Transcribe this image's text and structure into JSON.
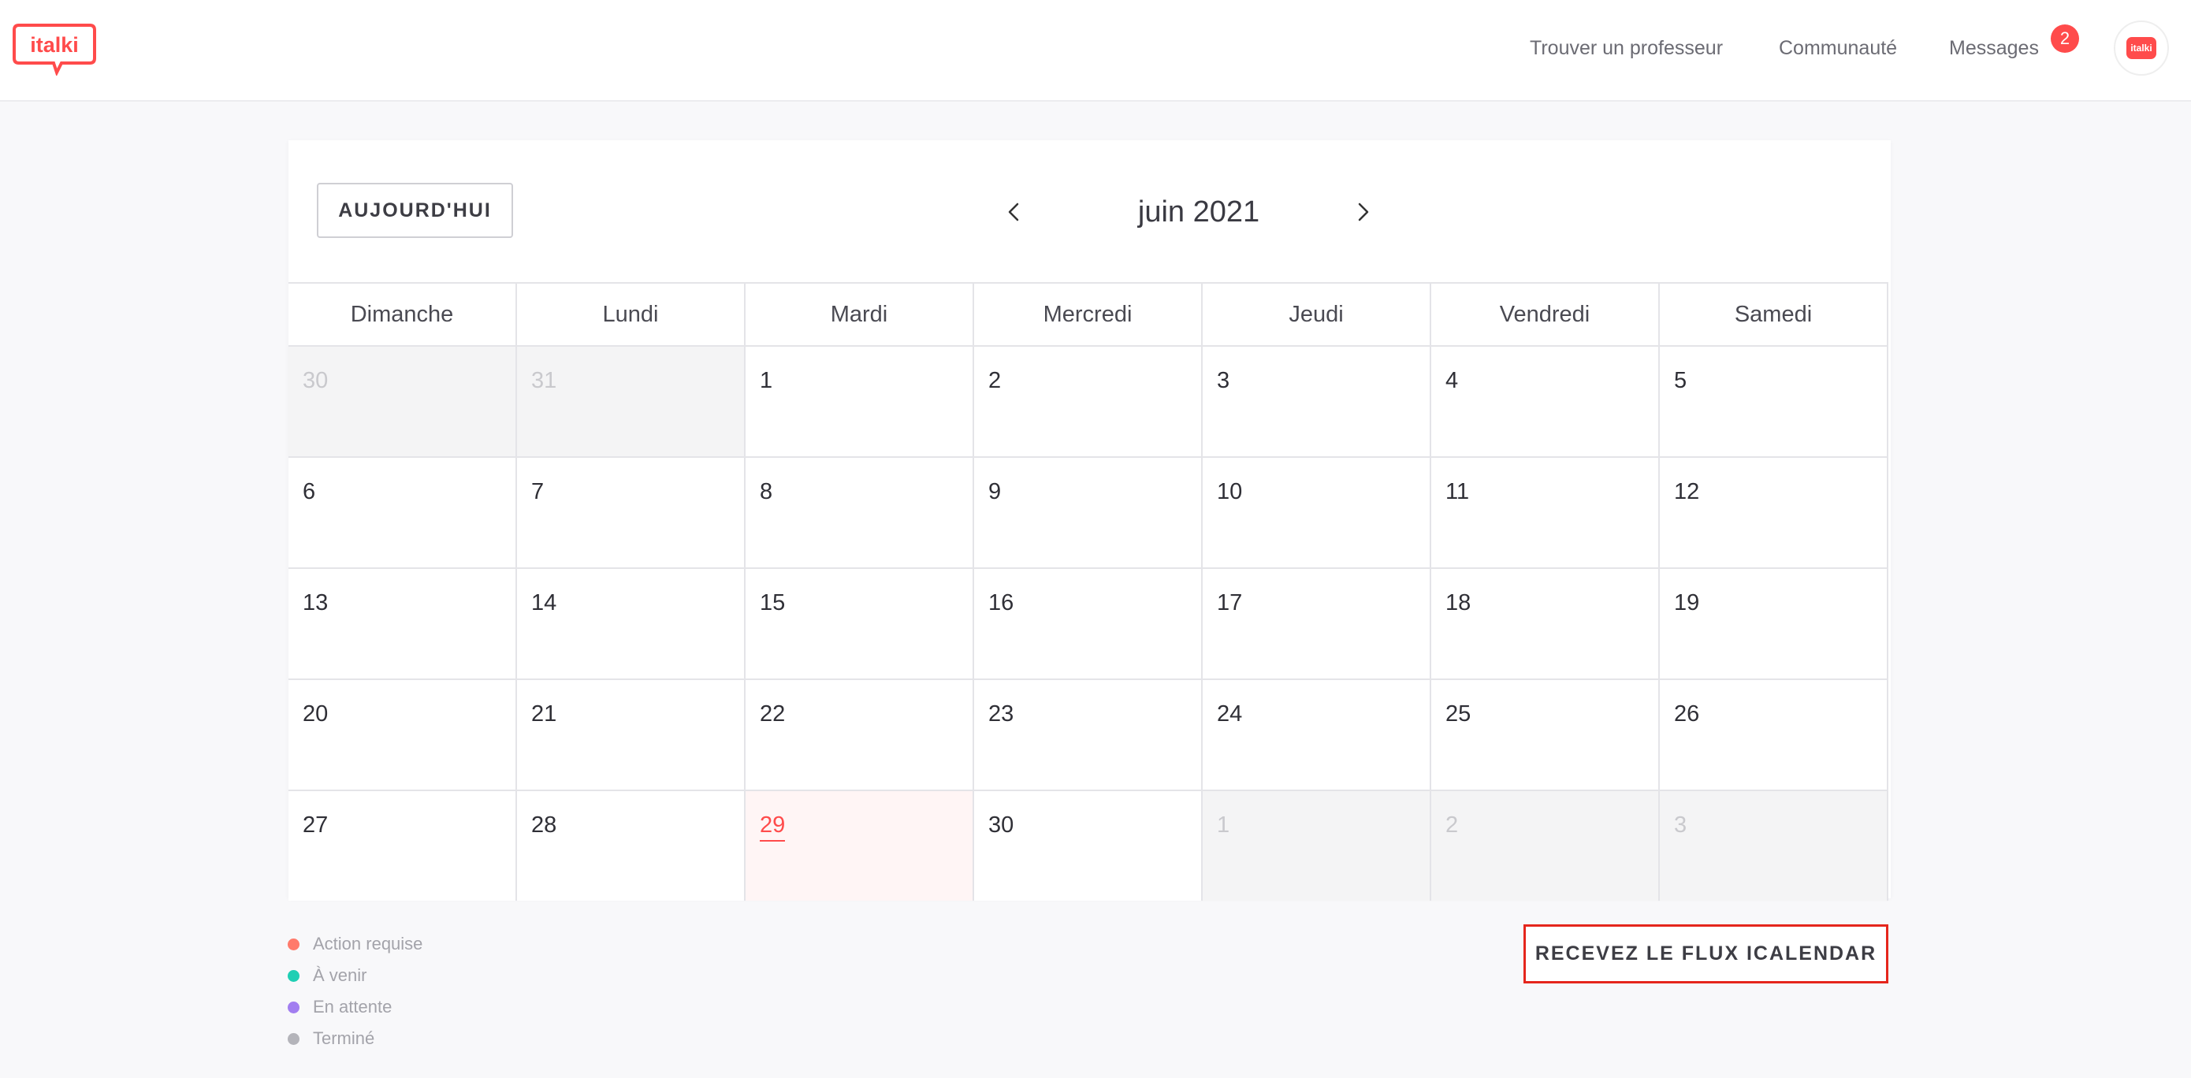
{
  "header": {
    "logo_text": "italki",
    "nav": {
      "find_teacher": "Trouver un professeur",
      "community": "Communauté",
      "messages": "Messages"
    },
    "messages_badge": "2",
    "avatar_text": "italki",
    "brand_color": "#ff4b4b"
  },
  "calendar": {
    "today_button": "AUJOURD'HUI",
    "month_title": "juin 2021",
    "prev_icon": "chevron-left-icon",
    "next_icon": "chevron-right-icon",
    "weekdays": [
      "Dimanche",
      "Lundi",
      "Mardi",
      "Mercredi",
      "Jeudi",
      "Vendredi",
      "Samedi"
    ],
    "weeks": [
      [
        {
          "d": "30",
          "outside": true
        },
        {
          "d": "31",
          "outside": true
        },
        {
          "d": "1"
        },
        {
          "d": "2"
        },
        {
          "d": "3"
        },
        {
          "d": "4"
        },
        {
          "d": "5"
        }
      ],
      [
        {
          "d": "6"
        },
        {
          "d": "7"
        },
        {
          "d": "8"
        },
        {
          "d": "9"
        },
        {
          "d": "10"
        },
        {
          "d": "11"
        },
        {
          "d": "12"
        }
      ],
      [
        {
          "d": "13"
        },
        {
          "d": "14"
        },
        {
          "d": "15"
        },
        {
          "d": "16"
        },
        {
          "d": "17"
        },
        {
          "d": "18"
        },
        {
          "d": "19"
        }
      ],
      [
        {
          "d": "20"
        },
        {
          "d": "21"
        },
        {
          "d": "22"
        },
        {
          "d": "23"
        },
        {
          "d": "24"
        },
        {
          "d": "25"
        },
        {
          "d": "26"
        }
      ],
      [
        {
          "d": "27"
        },
        {
          "d": "28"
        },
        {
          "d": "29",
          "today": true
        },
        {
          "d": "30"
        },
        {
          "d": "1",
          "outside": true
        },
        {
          "d": "2",
          "outside": true
        },
        {
          "d": "3",
          "outside": true
        }
      ]
    ]
  },
  "legend": [
    {
      "label": "Action requise",
      "color": "#ff7a6b"
    },
    {
      "label": "À venir",
      "color": "#1fcfb4"
    },
    {
      "label": "En attente",
      "color": "#a27ef0"
    },
    {
      "label": "Terminé",
      "color": "#b4b4ba"
    }
  ],
  "ical_button": "RECEVEZ LE FLUX ICALENDAR"
}
